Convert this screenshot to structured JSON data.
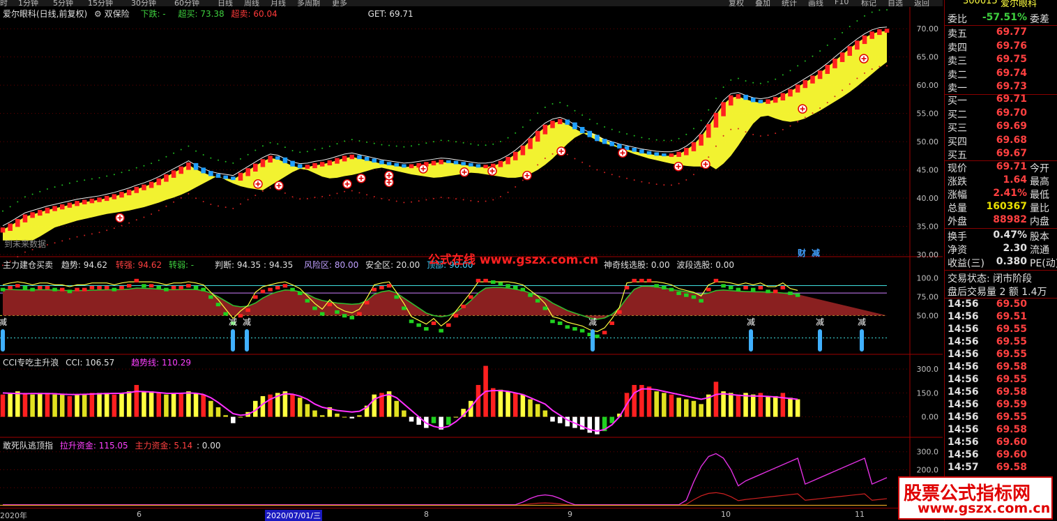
{
  "top_menu": {
    "left_items": [
      "时",
      "1分钟",
      "5分钟",
      "15分钟",
      "30分钟",
      "60分钟",
      "日线",
      "周线",
      "月线",
      "多周期",
      "更多"
    ],
    "right_items": [
      "复权",
      "叠加",
      "统计",
      "画线",
      "F10",
      "标记",
      "自选",
      "返回"
    ]
  },
  "header": {
    "stock_name": "爱尔眼科(日线,前复权)",
    "indicator": "双保险",
    "down_label": "下跌: -",
    "overbuy_label": "超买: 73.38",
    "oversell_label": "超卖: 60.04",
    "get_label": "GET: 69.71",
    "future_data": "到未来数据"
  },
  "main_axis": {
    "ticks": [
      "70.00",
      "65.00",
      "60.00",
      "55.00",
      "50.00",
      "45.00",
      "40.00",
      "35.00",
      "30.00"
    ]
  },
  "panel2": {
    "title": "主力建仓买卖",
    "trend": "趋势: 94.62",
    "turn_strong": "转强: 94.62",
    "turn_weak": "转弱: -",
    "judge": "判断: 94.35 : 94.35",
    "risk": "风险区: 80.00",
    "safe": "安全区: 20.00",
    "top": "顶部: 90.00",
    "wave": "波段选股: 0.00",
    "wonder": "神奇线选股: 0.00",
    "ticks": [
      "100.0",
      "75.00",
      "50.00"
    ],
    "reduce_label": "减",
    "tag1": "财",
    "tag2": "减"
  },
  "panel3": {
    "title": "CCI专吃主升浪",
    "cci": "CCI: 106.57",
    "trendline": "趋势线: 110.29",
    "ticks": [
      "300.0",
      "150.0",
      "0.00"
    ]
  },
  "panel4": {
    "title": "敢死队逃顶指",
    "lift": "拉升资金: 115.05",
    "main": "主力资金: 5.14",
    "zero": ": 0.00",
    "ticks": [
      "300.0",
      "200.0",
      "100.0"
    ]
  },
  "site_text": "公式在线 www.gszx.com.cn",
  "xaxis": {
    "labels": [
      "2020年",
      "6",
      "2020/07/01/三",
      "8",
      "9",
      "10",
      "11"
    ]
  },
  "quote": {
    "code": "300015",
    "name": "爱尔眼科",
    "weibi_label": "委比",
    "weibi_value": "-57.51%",
    "weicha_label": "委差",
    "sell": [
      {
        "label": "卖五",
        "price": "69.77"
      },
      {
        "label": "卖四",
        "price": "69.76"
      },
      {
        "label": "卖三",
        "price": "69.75"
      },
      {
        "label": "卖二",
        "price": "69.74"
      },
      {
        "label": "卖一",
        "price": "69.73"
      }
    ],
    "buy": [
      {
        "label": "买一",
        "price": "69.71"
      },
      {
        "label": "买二",
        "price": "69.70"
      },
      {
        "label": "买三",
        "price": "69.69"
      },
      {
        "label": "买四",
        "price": "69.68"
      },
      {
        "label": "买五",
        "price": "69.67"
      }
    ],
    "stats": [
      {
        "label": "现价",
        "value": "69.71",
        "label2": "今开",
        "color": "#ff4040"
      },
      {
        "label": "涨跌",
        "value": "1.64",
        "label2": "最高",
        "color": "#ff4040"
      },
      {
        "label": "涨幅",
        "value": "2.41%",
        "label2": "最低",
        "color": "#ff4040"
      },
      {
        "label": "总量",
        "value": "160367",
        "label2": "量比",
        "color": "#e8e000"
      },
      {
        "label": "外盘",
        "value": "88982",
        "label2": "内盘",
        "color": "#ff4040"
      }
    ],
    "stats2": [
      {
        "label": "换手",
        "value": "0.47%",
        "label2": "股本"
      },
      {
        "label": "净资",
        "value": "2.30",
        "label2": "流通"
      },
      {
        "label": "收益(三)",
        "value": "0.380",
        "label2": "PE(动)"
      }
    ],
    "trade_status": "交易状态: 闭市阶段",
    "after_hours": "盘后交易量 2  额 1.4万",
    "ticks": [
      {
        "time": "14:56",
        "price": "69.50"
      },
      {
        "time": "14:56",
        "price": "69.51"
      },
      {
        "time": "14:56",
        "price": "69.55"
      },
      {
        "time": "14:56",
        "price": "69.55"
      },
      {
        "time": "14:56",
        "price": "69.55"
      },
      {
        "time": "14:56",
        "price": "69.58"
      },
      {
        "time": "14:56",
        "price": "69.55"
      },
      {
        "time": "14:56",
        "price": "69.58"
      },
      {
        "time": "14:56",
        "price": "69.59"
      },
      {
        "time": "14:56",
        "price": "69.55"
      },
      {
        "time": "14:56",
        "price": "69.58"
      },
      {
        "time": "14:56",
        "price": "69.60"
      },
      {
        "time": "14:56",
        "price": "69.60"
      },
      {
        "time": "14:57",
        "price": "69.58"
      }
    ]
  },
  "watermark": {
    "line1": "股票公式指标网",
    "line2": "www.gszx.com.cn"
  },
  "chart_data": {
    "type": "line",
    "title": "爱尔眼科(日线,前复权)",
    "ylim": [
      30,
      72
    ],
    "x_ticks": [
      "2020年",
      "6",
      "2020/07/01/三",
      "8",
      "9",
      "10",
      "11"
    ],
    "series": [
      {
        "name": "close",
        "values": [
          34.5,
          35.2,
          36.0,
          36.8,
          37.2,
          37.6,
          38.0,
          38.3,
          38.6,
          38.9,
          39.2,
          39.4,
          39.6,
          39.8,
          40.1,
          40.4,
          40.8,
          41.2,
          41.7,
          42.1,
          42.6,
          43.2,
          43.9,
          44.6,
          45.3,
          46.0,
          45.2,
          44.6,
          44.1,
          43.8,
          43.6,
          43.4,
          44.2,
          45.0,
          45.8,
          46.6,
          47.2,
          47.0,
          46.4,
          45.8,
          45.5,
          45.6,
          45.9,
          46.1,
          46.4,
          46.8,
          47.2,
          47.4,
          47.1,
          46.8,
          46.5,
          46.2,
          46.0,
          45.8,
          45.6,
          45.7,
          45.9,
          46.1,
          46.3,
          46.5,
          46.4,
          46.2,
          46.0,
          45.8,
          45.6,
          45.6,
          45.8,
          46.3,
          47.0,
          47.9,
          49.0,
          50.3,
          51.6,
          52.7,
          53.4,
          53.7,
          53.2,
          52.4,
          51.7,
          51.0,
          50.3,
          49.8,
          49.4,
          49.0,
          48.7,
          48.4,
          48.1,
          47.9,
          47.7,
          47.6,
          47.6,
          47.9,
          48.6,
          49.6,
          51.0,
          52.8,
          54.8,
          56.7,
          57.9,
          58.1,
          57.6,
          57.2,
          57.0,
          57.2,
          57.6,
          58.3,
          59.0,
          59.8,
          60.6,
          61.4,
          62.3,
          63.3,
          64.4,
          65.5,
          66.6,
          67.6,
          68.5,
          69.2,
          69.6,
          69.7
        ]
      },
      {
        "name": "cci",
        "values": [
          140,
          150,
          160,
          150,
          140,
          150,
          150,
          140,
          140,
          130,
          140,
          140,
          150,
          150,
          150,
          140,
          150,
          160,
          200,
          160,
          160,
          150,
          140,
          150,
          150,
          160,
          150,
          140,
          100,
          60,
          10,
          -40,
          0,
          30,
          100,
          130,
          140,
          150,
          160,
          140,
          120,
          80,
          40,
          10,
          60,
          20,
          0,
          -10,
          10,
          70,
          140,
          150,
          160,
          100,
          40,
          -30,
          -50,
          -70,
          -40,
          -80,
          -50,
          0,
          50,
          100,
          200,
          320,
          180,
          170,
          160,
          150,
          140,
          110,
          80,
          40,
          -30,
          -40,
          -60,
          -70,
          -80,
          -100,
          -110,
          -90,
          -40,
          20,
          150,
          200,
          200,
          190,
          160,
          150,
          140,
          120,
          110,
          100,
          80,
          140,
          220,
          160,
          150,
          140,
          150,
          140,
          150,
          130,
          130,
          150,
          120,
          110
        ]
      },
      {
        "name": "趋势线",
        "values": [
          150,
          148,
          146,
          145,
          146,
          146,
          146,
          145,
          142,
          140,
          140,
          141,
          143,
          145,
          146,
          147,
          148,
          152,
          160,
          158,
          156,
          152,
          148,
          147,
          148,
          150,
          148,
          140,
          120,
          90,
          55,
          20,
          10,
          15,
          40,
          80,
          110,
          130,
          145,
          142,
          130,
          110,
          80,
          60,
          50,
          40,
          35,
          30,
          35,
          60,
          110,
          130,
          140,
          120,
          80,
          40,
          0,
          -40,
          -60,
          -70,
          -60,
          -30,
          10,
          60,
          120,
          160,
          165,
          165,
          160,
          150,
          140,
          120,
          100,
          80,
          40,
          10,
          -20,
          -40,
          -60,
          -80,
          -90,
          -80,
          -50,
          0,
          80,
          150,
          175,
          175,
          170,
          160,
          150,
          140,
          130,
          120,
          110,
          120,
          140,
          145,
          140,
          135,
          132,
          130,
          130,
          128,
          125,
          120,
          115,
          110
        ]
      }
    ]
  }
}
